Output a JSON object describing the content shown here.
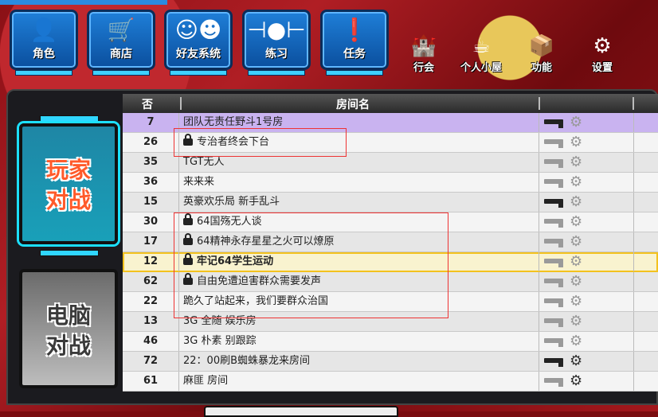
{
  "nav": {
    "big": [
      {
        "label": "角色",
        "icon": "person-icon"
      },
      {
        "label": "商店",
        "icon": "cart-icon"
      },
      {
        "label": "好友系统",
        "icon": "friends-icon"
      },
      {
        "label": "练习",
        "icon": "barbell-icon"
      },
      {
        "label": "任务",
        "icon": "quest-icon"
      }
    ],
    "small": [
      {
        "label": "行会",
        "icon": "guild-icon"
      },
      {
        "label": "个人小屋",
        "icon": "cup-icon"
      },
      {
        "label": "功能",
        "icon": "box-icon"
      },
      {
        "label": "设置",
        "icon": "gear-icon"
      }
    ]
  },
  "side": {
    "pvp": "玩家\n对战",
    "pve": "电脑\n对战"
  },
  "table": {
    "header_num": "否",
    "header_name": "房间名",
    "rows": [
      {
        "num": "7",
        "name": "团队无责任野斗1号房",
        "locked": false,
        "style": "hl",
        "gun": "dark",
        "gear": "light"
      },
      {
        "num": "26",
        "name": "专治者终会下台",
        "locked": true,
        "style": "norm",
        "gun": "light",
        "gear": "light"
      },
      {
        "num": "35",
        "name": "TGT无人",
        "locked": false,
        "style": "alt",
        "gun": "light",
        "gear": "light"
      },
      {
        "num": "36",
        "name": "来来来",
        "locked": false,
        "style": "norm",
        "gun": "light",
        "gear": "light"
      },
      {
        "num": "15",
        "name": "英豪欢乐局  新手乱斗",
        "locked": false,
        "style": "alt",
        "gun": "dark",
        "gear": "light"
      },
      {
        "num": "30",
        "name": "64国殇无人谈",
        "locked": true,
        "style": "norm",
        "gun": "light",
        "gear": "light"
      },
      {
        "num": "17",
        "name": "64精神永存星星之火可以燎原",
        "locked": true,
        "style": "alt",
        "gun": "light",
        "gear": "light"
      },
      {
        "num": "12",
        "name": "牢记64学生运动",
        "locked": true,
        "style": "sel",
        "gun": "light",
        "gear": "light"
      },
      {
        "num": "62",
        "name": "自由免遭迫害群众需要发声",
        "locked": true,
        "style": "alt",
        "gun": "light",
        "gear": "light"
      },
      {
        "num": "22",
        "name": "跪久了站起来，我们要群众治国",
        "locked": false,
        "style": "norm",
        "gun": "light",
        "gear": "light"
      },
      {
        "num": "13",
        "name": "3G  全随  娱乐房",
        "locked": false,
        "style": "alt",
        "gun": "light",
        "gear": "light"
      },
      {
        "num": "46",
        "name": "3G  朴素  别跟踪",
        "locked": false,
        "style": "norm",
        "gun": "light",
        "gear": "light"
      },
      {
        "num": "72",
        "name": "22：00刷B蜘蛛暴龙来房间",
        "locked": false,
        "style": "alt",
        "gun": "dark",
        "gear": "dark"
      },
      {
        "num": "61",
        "name": "麻匪  房间",
        "locked": false,
        "style": "norm",
        "gun": "light",
        "gear": "dark"
      }
    ]
  }
}
